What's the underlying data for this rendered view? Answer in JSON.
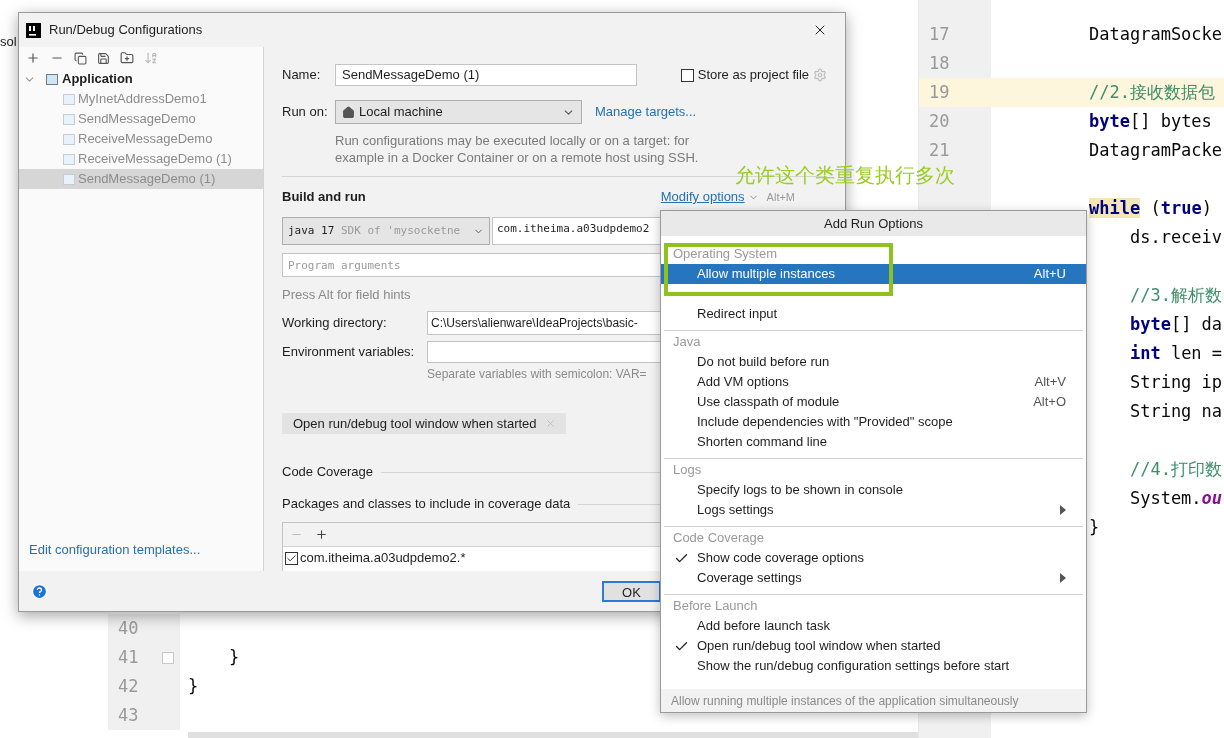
{
  "editor": {
    "left_pane": {
      "cut_text": "sol",
      "rows": [
        {
          "number": "40",
          "current": false,
          "fold": false
        },
        {
          "number": "41",
          "current": false,
          "fold": true,
          "segments": [
            {
              "text": "    }",
              "kind": "plain"
            }
          ]
        },
        {
          "number": "42",
          "current": false,
          "fold": false,
          "segments": [
            {
              "text": "}",
              "kind": "plain"
            }
          ]
        },
        {
          "number": "43",
          "current": false,
          "fold": false
        }
      ]
    },
    "right_pane": {
      "rows": [
        {
          "number": "17",
          "current": false,
          "segments": [
            {
              "text": "DatagramSocke",
              "kind": "plain"
            }
          ]
        },
        {
          "number": "18",
          "current": false
        },
        {
          "number": "19",
          "current": true,
          "segments": [
            {
              "text": "//2.接收数据包",
              "kind": "comment"
            }
          ]
        },
        {
          "number": "20",
          "current": false,
          "segments": [
            {
              "text": "byte",
              "kind": "keyword"
            },
            {
              "text": "[] bytes",
              "kind": "plain"
            }
          ]
        },
        {
          "number": "21",
          "current": false,
          "segments": [
            {
              "text": "DatagramPacke",
              "kind": "plain"
            }
          ]
        },
        {
          "current": false
        },
        {
          "current": false,
          "segments": [
            {
              "text": "while",
              "kind": "matched"
            },
            {
              "text": " (",
              "kind": "plain"
            },
            {
              "text": "true",
              "kind": "keyword"
            },
            {
              "text": ")",
              "kind": "plain"
            }
          ]
        },
        {
          "current": false,
          "segments": [
            {
              "text": "    ds.receiv",
              "kind": "plain"
            }
          ]
        },
        {
          "current": false
        },
        {
          "current": false,
          "segments": [
            {
              "text": "    //3.解析数",
              "kind": "comment"
            }
          ]
        },
        {
          "current": false,
          "segments": [
            {
              "text": "    byte",
              "kind": "keyword"
            },
            {
              "text": "[] da",
              "kind": "plain"
            }
          ]
        },
        {
          "current": false,
          "segments": [
            {
              "text": "    int",
              "kind": "keyword"
            },
            {
              "text": " len =",
              "kind": "plain"
            }
          ]
        },
        {
          "current": false,
          "segments": [
            {
              "text": "    String ip",
              "kind": "plain"
            }
          ]
        },
        {
          "current": false,
          "segments": [
            {
              "text": "    String na",
              "kind": "plain"
            }
          ]
        },
        {
          "current": false
        },
        {
          "current": false,
          "segments": [
            {
              "text": "    //4.打印数",
              "kind": "comment"
            }
          ]
        },
        {
          "current": false,
          "segments": [
            {
              "text": "    System.",
              "kind": "plain"
            },
            {
              "text": "ou",
              "kind": "field"
            }
          ]
        },
        {
          "current": false,
          "segments": [
            {
              "text": "}",
              "kind": "plain"
            }
          ]
        }
      ]
    }
  },
  "dialog": {
    "title": "Run/Debug Configurations",
    "tree": {
      "label": "Application",
      "expanded": true,
      "children": [
        {
          "label": "MyInetAddressDemo1",
          "selected": false
        },
        {
          "label": "SendMessageDemo",
          "selected": false
        },
        {
          "label": "ReceiveMessageDemo",
          "selected": false
        },
        {
          "label": "ReceiveMessageDemo (1)",
          "selected": false
        },
        {
          "label": "SendMessageDemo (1)",
          "selected": true
        }
      ]
    },
    "templates_link": "Edit configuration templates...",
    "name": {
      "label": "Name:",
      "value": "SendMessageDemo (1)"
    },
    "store_as_project_file": {
      "label": "Store as project file",
      "checked": false
    },
    "run_on": {
      "label": "Run on:",
      "value": "Local machine",
      "link": "Manage targets...",
      "description": [
        "Run configurations may be executed locally or on a target: for",
        "example in a Docker Container or on a remote host using SSH."
      ]
    },
    "build_and_run": {
      "title": "Build and run",
      "modify_options": "Modify options",
      "modify_shortcut": "Alt+M",
      "sdk": {
        "version": "java 17",
        "detail": " SDK of 'mysocketne"
      },
      "main_class": "com.itheima.a03udpdemo2",
      "program_arguments": {
        "placeholder": "Program arguments"
      },
      "hint": "Press Alt for field hints",
      "working_directory": {
        "label": "Working directory:",
        "value": "C:\\Users\\alienware\\IdeaProjects\\basic-"
      },
      "environment_variables": {
        "label": "Environment variables:",
        "hint": "Separate variables with semicolon: VAR="
      },
      "option_chip": "Open run/debug tool window when started"
    },
    "code_coverage": {
      "title": "Code Coverage",
      "packages_title": "Packages and classes to include in coverage data",
      "entries": [
        {
          "label": "com.itheima.a03udpdemo2.*",
          "checked": true
        }
      ]
    },
    "ok_button": "OK"
  },
  "popup": {
    "title": "Add Run Options",
    "groups": [
      {
        "header": "Operating System",
        "items": [
          {
            "kind": "option",
            "label": "Allow multiple instances",
            "shortcut": "Alt+U",
            "selected": true,
            "checked": false
          },
          {
            "kind": "covered"
          },
          {
            "kind": "option",
            "label": "Redirect input",
            "selected": false,
            "checked": false,
            "submenu": false
          }
        ]
      },
      {
        "header": "Java",
        "items": [
          {
            "kind": "option",
            "label": "Do not build before run",
            "selected": false,
            "checked": false,
            "submenu": false
          },
          {
            "kind": "option",
            "label": "Add VM options",
            "shortcut": "Alt+V",
            "selected": false,
            "checked": false
          },
          {
            "kind": "option",
            "label": "Use classpath of module",
            "shortcut": "Alt+O",
            "selected": false,
            "checked": false
          },
          {
            "kind": "option",
            "label": "Include dependencies with \"Provided\" scope",
            "selected": false,
            "checked": false,
            "submenu": false
          },
          {
            "kind": "option",
            "label": "Shorten command line",
            "selected": false,
            "checked": false,
            "submenu": false
          }
        ]
      },
      {
        "header": "Logs",
        "items": [
          {
            "kind": "option",
            "label": "Specify logs to be shown in console",
            "selected": false,
            "checked": false,
            "submenu": false
          },
          {
            "kind": "option",
            "label": "Logs settings",
            "selected": false,
            "checked": false,
            "submenu": true
          }
        ]
      },
      {
        "header": "Code Coverage",
        "items": [
          {
            "kind": "option",
            "label": "Show code coverage options",
            "selected": false,
            "checked": true,
            "submenu": false
          },
          {
            "kind": "option",
            "label": "Coverage settings",
            "selected": false,
            "checked": false,
            "submenu": true
          }
        ]
      },
      {
        "header": "Before Launch",
        "items": [
          {
            "kind": "option",
            "label": "Add before launch task",
            "selected": false,
            "checked": false,
            "submenu": false
          },
          {
            "kind": "option",
            "label": "Open run/debug tool window when started",
            "selected": false,
            "checked": true,
            "submenu": false
          },
          {
            "kind": "option",
            "label": "Show the run/debug configuration settings before start",
            "selected": false,
            "checked": false,
            "submenu": false
          }
        ]
      }
    ],
    "footer": "Allow running multiple instances of the application simultaneously"
  },
  "annotation": {
    "text": "允许这个类重复执行多次"
  }
}
